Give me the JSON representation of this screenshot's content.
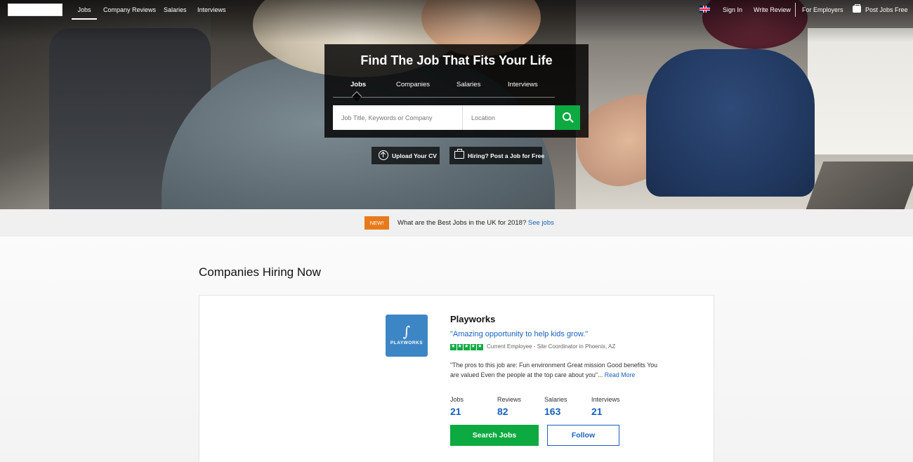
{
  "topnav": {
    "items": [
      {
        "label": "Jobs",
        "active": true
      },
      {
        "label": "Company Reviews"
      },
      {
        "label": "Salaries"
      },
      {
        "label": "Interviews"
      }
    ],
    "right": {
      "sign_in": "Sign In",
      "write_review": "Write Review",
      "for_employers": "For Employers",
      "post_jobs": "Post Jobs Free"
    },
    "icons": {
      "flag": "uk-flag-icon",
      "briefcase": "briefcase-icon"
    }
  },
  "hero": {
    "title": "Find The Job That Fits Your Life",
    "tabs": [
      {
        "label": "Jobs",
        "active": true
      },
      {
        "label": "Companies"
      },
      {
        "label": "Salaries"
      },
      {
        "label": "Interviews"
      }
    ],
    "search": {
      "job_placeholder": "Job Title, Keywords or Company",
      "location_placeholder": "Location",
      "button_icon": "search-icon",
      "accent": "#0caa41"
    },
    "actions": {
      "upload_cv": "Upload Your CV",
      "post_job": "Hiring? Post a Job for Free"
    }
  },
  "banner": {
    "badge": "NEW!",
    "text": "What are the Best Jobs in the UK for 2018?",
    "link": "See jobs",
    "badge_color": "#e97a1a"
  },
  "companies": {
    "title": "Companies Hiring Now",
    "card": {
      "logo_text": "PLAYWORKS",
      "logo_mark": "∫",
      "name": "Playworks",
      "quote": "\"Amazing opportunity to help kids grow.\"",
      "rating_stars": 5,
      "reviewer": "Current Employee - Site Coordinator in Phoenix, AZ",
      "review_text": "\"The pros to this job are: Fun environment Great mission Good benefits You are valued Even the people at the top care about you\"...",
      "read_more": "Read More",
      "stats": [
        {
          "label": "Jobs",
          "value": "21"
        },
        {
          "label": "Reviews",
          "value": "82"
        },
        {
          "label": "Salaries",
          "value": "163"
        },
        {
          "label": "Interviews",
          "value": "21"
        }
      ],
      "search_jobs": "Search Jobs",
      "follow": "Follow",
      "link_color": "#1861bf"
    }
  }
}
